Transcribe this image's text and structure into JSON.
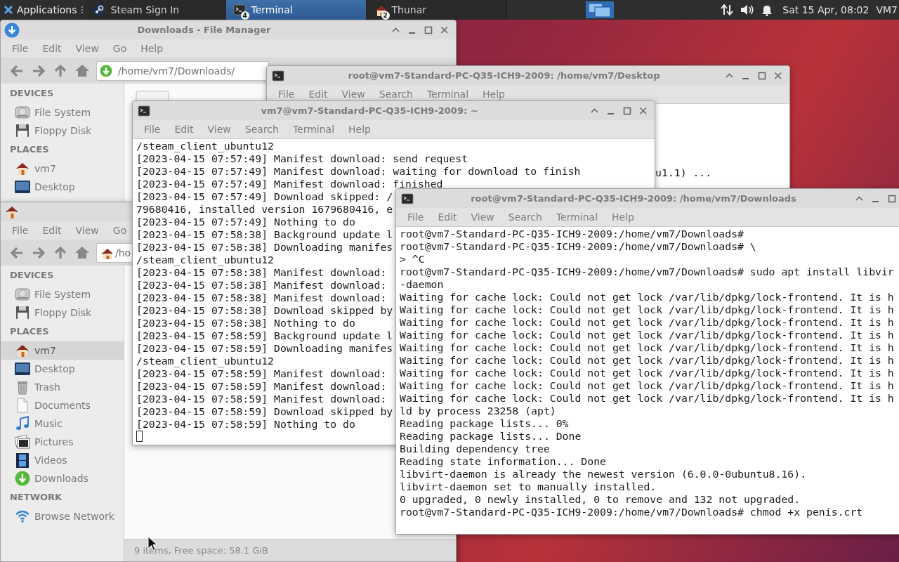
{
  "panel": {
    "menu_button": "Applications",
    "tasks": [
      {
        "kind": "steam",
        "label": "Steam Sign In",
        "selected": false
      },
      {
        "kind": "terminal",
        "label": "Terminal",
        "count": "4",
        "selected": true
      },
      {
        "kind": "home",
        "label": "Thunar",
        "count": "2",
        "selected": false
      }
    ],
    "clock": "Sat 15 Apr, 08:02",
    "user": "VM7"
  },
  "windows": [
    {
      "kind": "downloads_folder",
      "title": "Downloads - File Manager",
      "menu": [
        "File",
        "Edit",
        "View",
        "Go",
        "Help"
      ],
      "location": "/home/vm7/Downloads/",
      "sidebar": [
        {
          "heading": "DEVICES",
          "items": [
            {
              "kind": "drive",
              "label": "File System",
              "selected": false
            },
            {
              "kind": "floppy",
              "label": "Floppy Disk",
              "selected": false
            }
          ]
        },
        {
          "heading": "PLACES",
          "items": [
            {
              "kind": "home",
              "label": "vm7",
              "selected": false
            },
            {
              "kind": "desktop",
              "label": "Desktop",
              "selected": false
            }
          ]
        }
      ]
    },
    {
      "kind": "terminal",
      "title": "root@vm7-Standard-PC-Q35-ICH9-2009: /home/vm7/Desktop",
      "menu": [
        "File",
        "Edit",
        "View",
        "Search",
        "Terminal",
        "Help"
      ],
      "lines": [
        "u1.1) ..."
      ],
      "cursor": false
    },
    {
      "kind": "home_folder",
      "menu": [
        "File",
        "Edit",
        "View",
        "Go"
      ],
      "location": "/ho",
      "sidebar": [
        {
          "heading": "DEVICES",
          "items": [
            {
              "kind": "drive",
              "label": "File System",
              "selected": false
            },
            {
              "kind": "floppy",
              "label": "Floppy Disk",
              "selected": false
            }
          ]
        },
        {
          "heading": "PLACES",
          "items": [
            {
              "kind": "home",
              "label": "vm7",
              "selected": true
            },
            {
              "kind": "desktop",
              "label": "Desktop",
              "selected": false
            },
            {
              "kind": "trash",
              "label": "Trash",
              "selected": false
            },
            {
              "kind": "document",
              "label": "Documents",
              "selected": false
            },
            {
              "kind": "music",
              "label": "Music",
              "selected": false
            },
            {
              "kind": "pictures",
              "label": "Pictures",
              "selected": false
            },
            {
              "kind": "videos",
              "label": "Videos",
              "selected": false
            },
            {
              "kind": "downloads",
              "label": "Downloads",
              "selected": false
            }
          ]
        },
        {
          "heading": "NETWORK",
          "items": [
            {
              "kind": "network",
              "label": "Browse Network",
              "selected": false
            }
          ]
        }
      ],
      "status": "9 items, Free space: 58.1 GiB"
    },
    {
      "kind": "terminal",
      "title": "vm7@vm7-Standard-PC-Q35-ICH9-2009: ~",
      "menu": [
        "File",
        "Edit",
        "View",
        "Search",
        "Terminal",
        "Help"
      ],
      "lines": [
        "/steam_client_ubuntu12",
        "[2023-04-15 07:57:49] Manifest download: send request",
        "[2023-04-15 07:57:49] Manifest download: waiting for download to finish",
        "[2023-04-15 07:57:49] Manifest download: finished",
        "[2023-04-15 07:57:49] Download skipped: /",
        "79680416, installed version 1679680416, e",
        "[2023-04-15 07:57:49] Nothing to do",
        "[2023-04-15 07:58:38] Background update l",
        "[2023-04-15 07:58:38] Downloading manifes",
        "/steam_client_ubuntu12",
        "[2023-04-15 07:58:38] Manifest download:",
        "[2023-04-15 07:58:38] Manifest download:",
        "[2023-04-15 07:58:38] Manifest download:",
        "[2023-04-15 07:58:38] Download skipped by",
        "[2023-04-15 07:58:38] Nothing to do",
        "[2023-04-15 07:58:59] Background update l",
        "[2023-04-15 07:58:59] Downloading manifes",
        "/steam_client_ubuntu12",
        "[2023-04-15 07:58:59] Manifest download:",
        "[2023-04-15 07:58:59] Manifest download:",
        "[2023-04-15 07:58:59] Manifest download:",
        "[2023-04-15 07:58:59] Download skipped by",
        "[2023-04-15 07:58:59] Nothing to do"
      ],
      "cursor": true
    },
    {
      "kind": "terminal",
      "title": "root@vm7-Standard-PC-Q35-ICH9-2009: /home/vm7/Downloads",
      "menu": [
        "File",
        "Edit",
        "View",
        "Search",
        "Terminal",
        "Help"
      ],
      "lines": [
        "root@vm7-Standard-PC-Q35-ICH9-2009:/home/vm7/Downloads#",
        "root@vm7-Standard-PC-Q35-ICH9-2009:/home/vm7/Downloads# \\",
        "> ^C",
        "root@vm7-Standard-PC-Q35-ICH9-2009:/home/vm7/Downloads# sudo apt install libvir",
        "-daemon",
        "Waiting for cache lock: Could not get lock /var/lib/dpkg/lock-frontend. It is h",
        "Waiting for cache lock: Could not get lock /var/lib/dpkg/lock-frontend. It is h",
        "Waiting for cache lock: Could not get lock /var/lib/dpkg/lock-frontend. It is h",
        "Waiting for cache lock: Could not get lock /var/lib/dpkg/lock-frontend. It is h",
        "Waiting for cache lock: Could not get lock /var/lib/dpkg/lock-frontend. It is h",
        "Waiting for cache lock: Could not get lock /var/lib/dpkg/lock-frontend. It is h",
        "Waiting for cache lock: Could not get lock /var/lib/dpkg/lock-frontend. It is h",
        "Waiting for cache lock: Could not get lock /var/lib/dpkg/lock-frontend. It is h",
        "Waiting for cache lock: Could not get lock /var/lib/dpkg/lock-frontend. It is h",
        "ld by process 23258 (apt)",
        "Reading package lists... 0%",
        "Reading package lists... Done",
        "Building dependency tree",
        "Reading state information... Done",
        "libvirt-daemon is already the newest version (6.0.0-0ubuntu8.16).",
        "libvirt-daemon set to manually installed.",
        "0 upgraded, 0 newly installed, 0 to remove and 132 not upgraded.",
        "root@vm7-Standard-PC-Q35-ICH9-2009:/home/vm7/Downloads# chmod +x penis.crt"
      ],
      "cursor": false
    }
  ]
}
